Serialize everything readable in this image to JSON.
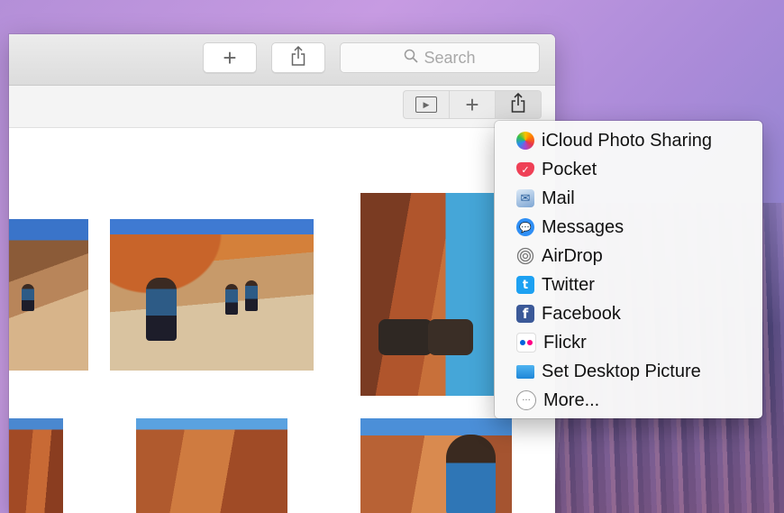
{
  "toolbar": {
    "add_symbol": "+",
    "share_symbol": "⇧",
    "search_placeholder": "Search"
  },
  "secondary_toolbar": {
    "slideshow_symbol": "▶",
    "add_symbol": "+",
    "share_symbol": "⇧"
  },
  "share_menu": {
    "items": [
      {
        "label": "iCloud Photo Sharing",
        "icon": "icloud-photo-sharing-icon"
      },
      {
        "label": "Pocket",
        "icon": "pocket-icon"
      },
      {
        "label": "Mail",
        "icon": "mail-icon"
      },
      {
        "label": "Messages",
        "icon": "messages-icon"
      },
      {
        "label": "AirDrop",
        "icon": "airdrop-icon"
      },
      {
        "label": "Twitter",
        "icon": "twitter-icon"
      },
      {
        "label": "Facebook",
        "icon": "facebook-icon"
      },
      {
        "label": "Flickr",
        "icon": "flickr-icon"
      },
      {
        "label": "Set Desktop Picture",
        "icon": "desktop-picture-icon"
      },
      {
        "label": "More...",
        "icon": "more-icon"
      }
    ]
  },
  "colors": {
    "twitter": "#1da1f2",
    "facebook": "#3b5998",
    "flickr_blue": "#0063dc",
    "flickr_pink": "#ff0084",
    "pocket": "#ef4056",
    "messages": "#2f8ff5"
  }
}
